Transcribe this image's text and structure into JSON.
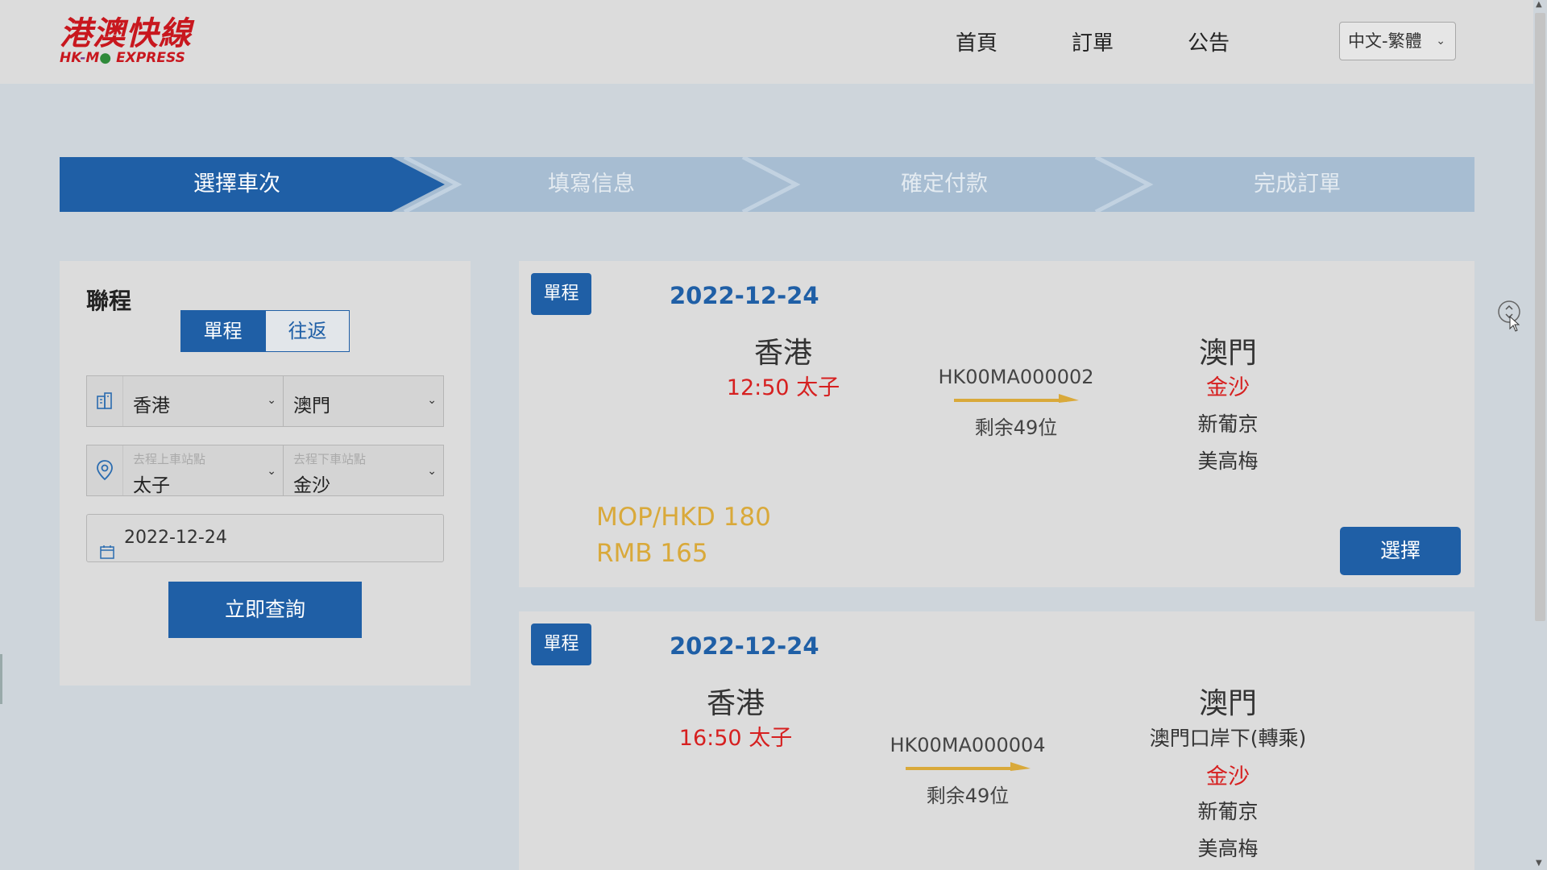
{
  "header": {
    "logo_cn": "港澳快線",
    "logo_en_hk": "HK",
    "logo_en_dash": "-",
    "logo_en_mo": "M",
    "logo_en_leaf": "●",
    "logo_en_express": "EXPRESS",
    "nav": [
      "首頁",
      "訂單",
      "公告"
    ],
    "language": "中文-繁體"
  },
  "steps": [
    "選擇車次",
    "填寫信息",
    "確定付款",
    "完成訂單"
  ],
  "search": {
    "title": "聯程",
    "trip_types": [
      "單程",
      "往返"
    ],
    "from_city": "香港",
    "to_city": "澳門",
    "from_stop_placeholder": "去程上車站點",
    "from_stop": "太子",
    "to_stop_placeholder": "去程下車站點",
    "to_stop": "金沙",
    "date": "2022-12-24",
    "submit_label": "立即查詢"
  },
  "trips": [
    {
      "badge": "單程",
      "date": "2022-12-24",
      "from_city": "香港",
      "depart": "12:50 太子",
      "train_no": "HK00MA000002",
      "seats": "剩余49位",
      "to_city": "澳門",
      "stops": [
        "金沙",
        "新葡京",
        "美高梅"
      ],
      "price_mop": "MOP/HKD 180",
      "price_rmb": "RMB 165",
      "select_label": "選擇"
    },
    {
      "badge": "單程",
      "date": "2022-12-24",
      "from_city": "香港",
      "depart": "16:50 太子",
      "train_no": "HK00MA000004",
      "seats": "剩余49位",
      "to_city": "澳門",
      "stops": [
        "澳門口岸下(轉乘)",
        "金沙",
        "新葡京",
        "美高梅"
      ]
    }
  ],
  "colors": {
    "primary": "#1f5fa6",
    "highlight_red": "#d62020",
    "price_gold": "#d9a93a",
    "step_inactive": "#a7bdd2"
  }
}
